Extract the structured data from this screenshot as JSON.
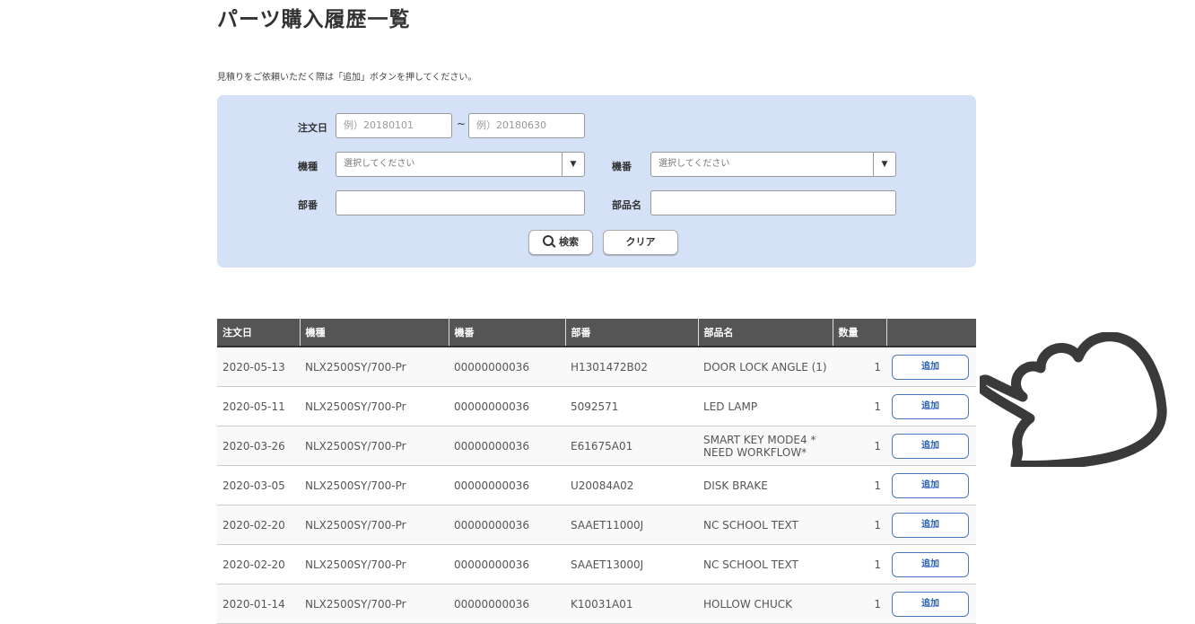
{
  "page": {
    "title": "パーツ購入履歴一覧",
    "note": "見積りをご依頼いただく際は「追加」ボタンを押してください。"
  },
  "search": {
    "order_date_label": "注文日",
    "date_from_placeholder": "例）20180101",
    "date_separator": "~",
    "date_to_placeholder": "例）20180630",
    "model_label": "機種",
    "model_value": "選択してください",
    "serial_label": "機番",
    "serial_value": "選択してください",
    "part_no_label": "部番",
    "part_name_label": "部品名",
    "search_button": "検索",
    "clear_button": "クリア"
  },
  "table": {
    "headers": [
      "注文日",
      "機種",
      "機番",
      "部番",
      "部品名",
      "数量",
      ""
    ],
    "add_label": "追加",
    "rows": [
      {
        "date": "2020-05-13",
        "model": "NLX2500SY/700-Pr",
        "serial": "00000000036",
        "part_no": "H1301472B02",
        "part_name": "DOOR LOCK ANGLE (1)",
        "qty": "1"
      },
      {
        "date": "2020-05-11",
        "model": "NLX2500SY/700-Pr",
        "serial": "00000000036",
        "part_no": "5092571",
        "part_name": "LED LAMP",
        "qty": "1"
      },
      {
        "date": "2020-03-26",
        "model": "NLX2500SY/700-Pr",
        "serial": "00000000036",
        "part_no": "E61675A01",
        "part_name": "SMART KEY MODE4 * NEED WORKFLOW*",
        "qty": "1"
      },
      {
        "date": "2020-03-05",
        "model": "NLX2500SY/700-Pr",
        "serial": "00000000036",
        "part_no": "U20084A02",
        "part_name": "DISK BRAKE",
        "qty": "1"
      },
      {
        "date": "2020-02-20",
        "model": "NLX2500SY/700-Pr",
        "serial": "00000000036",
        "part_no": "SAAET11000J",
        "part_name": "NC SCHOOL TEXT",
        "qty": "1"
      },
      {
        "date": "2020-02-20",
        "model": "NLX2500SY/700-Pr",
        "serial": "00000000036",
        "part_no": "SAAET13000J",
        "part_name": "NC SCHOOL TEXT",
        "qty": "1"
      },
      {
        "date": "2020-01-14",
        "model": "NLX2500SY/700-Pr",
        "serial": "00000000036",
        "part_no": "K10031A01",
        "part_name": "HOLLOW CHUCK",
        "qty": "1"
      }
    ]
  },
  "colors": {
    "panel_bg": "#d5e1f7",
    "header_bg": "#555555",
    "accent": "#4a78c8"
  },
  "icons": {
    "search": "search-icon",
    "dropdown": "triangle-down-icon",
    "pointer": "pointing-hand-icon"
  }
}
